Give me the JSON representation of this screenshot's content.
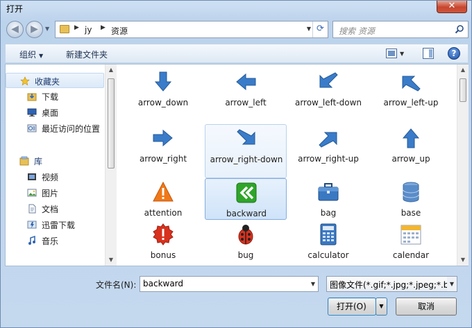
{
  "window": {
    "title": "打开",
    "close_label": "✕"
  },
  "address": {
    "crumbs": [
      "jy",
      "资源"
    ]
  },
  "search": {
    "placeholder": "搜索 资源"
  },
  "toolbar": {
    "organize_label": "组织",
    "new_folder_label": "新建文件夹",
    "help_label": "?"
  },
  "nav": {
    "items": [
      {
        "label": "收藏夹",
        "icon": "star-icon",
        "group": true
      },
      {
        "label": "下载",
        "icon": "downloads-icon",
        "group": false
      },
      {
        "label": "桌面",
        "icon": "desktop-icon",
        "group": false
      },
      {
        "label": "最近访问的位置",
        "icon": "recent-places-icon",
        "group": false
      },
      {
        "label": "库",
        "icon": "library-icon",
        "group": true
      },
      {
        "label": "视频",
        "icon": "video-icon",
        "group": false
      },
      {
        "label": "图片",
        "icon": "pictures-icon",
        "group": false
      },
      {
        "label": "文档",
        "icon": "documents-icon",
        "group": false
      },
      {
        "label": "迅雷下载",
        "icon": "thunder-download-icon",
        "group": false
      },
      {
        "label": "音乐",
        "icon": "music-icon",
        "group": false
      }
    ]
  },
  "files": [
    {
      "label": "arrow_down",
      "icon": "arrow-down-icon"
    },
    {
      "label": "arrow_left",
      "icon": "arrow-left-icon"
    },
    {
      "label": "arrow_left-down",
      "icon": "arrow-left-down-icon"
    },
    {
      "label": "arrow_left-up",
      "icon": "arrow-left-up-icon"
    },
    {
      "label": "arrow_right",
      "icon": "arrow-right-icon"
    },
    {
      "label": "arrow_right-down",
      "icon": "arrow-right-down-icon",
      "state": "hover"
    },
    {
      "label": "arrow_right-up",
      "icon": "arrow-right-up-icon"
    },
    {
      "label": "arrow_up",
      "icon": "arrow-up-icon"
    },
    {
      "label": "attention",
      "icon": "attention-icon"
    },
    {
      "label": "backward",
      "icon": "backward-icon",
      "state": "selected"
    },
    {
      "label": "bag",
      "icon": "bag-icon"
    },
    {
      "label": "base",
      "icon": "database-icon"
    },
    {
      "label": "bonus",
      "icon": "bonus-icon"
    },
    {
      "label": "bug",
      "icon": "bug-icon"
    },
    {
      "label": "calculator",
      "icon": "calculator-icon"
    },
    {
      "label": "calendar",
      "icon": "calendar-icon"
    }
  ],
  "bottom": {
    "filename_label": "文件名(N):",
    "filename_value": "backward",
    "filetype_value": "图像文件(*.gif;*.jpg;*.jpeg;*.br",
    "open_label": "打开(O)",
    "cancel_label": "取消"
  },
  "colors": {
    "icon_blue": "#3a7cc9",
    "icon_orange": "#f07818",
    "icon_red": "#d8311e",
    "icon_green": "#2fa52a",
    "selection": "#cfe3f9"
  }
}
